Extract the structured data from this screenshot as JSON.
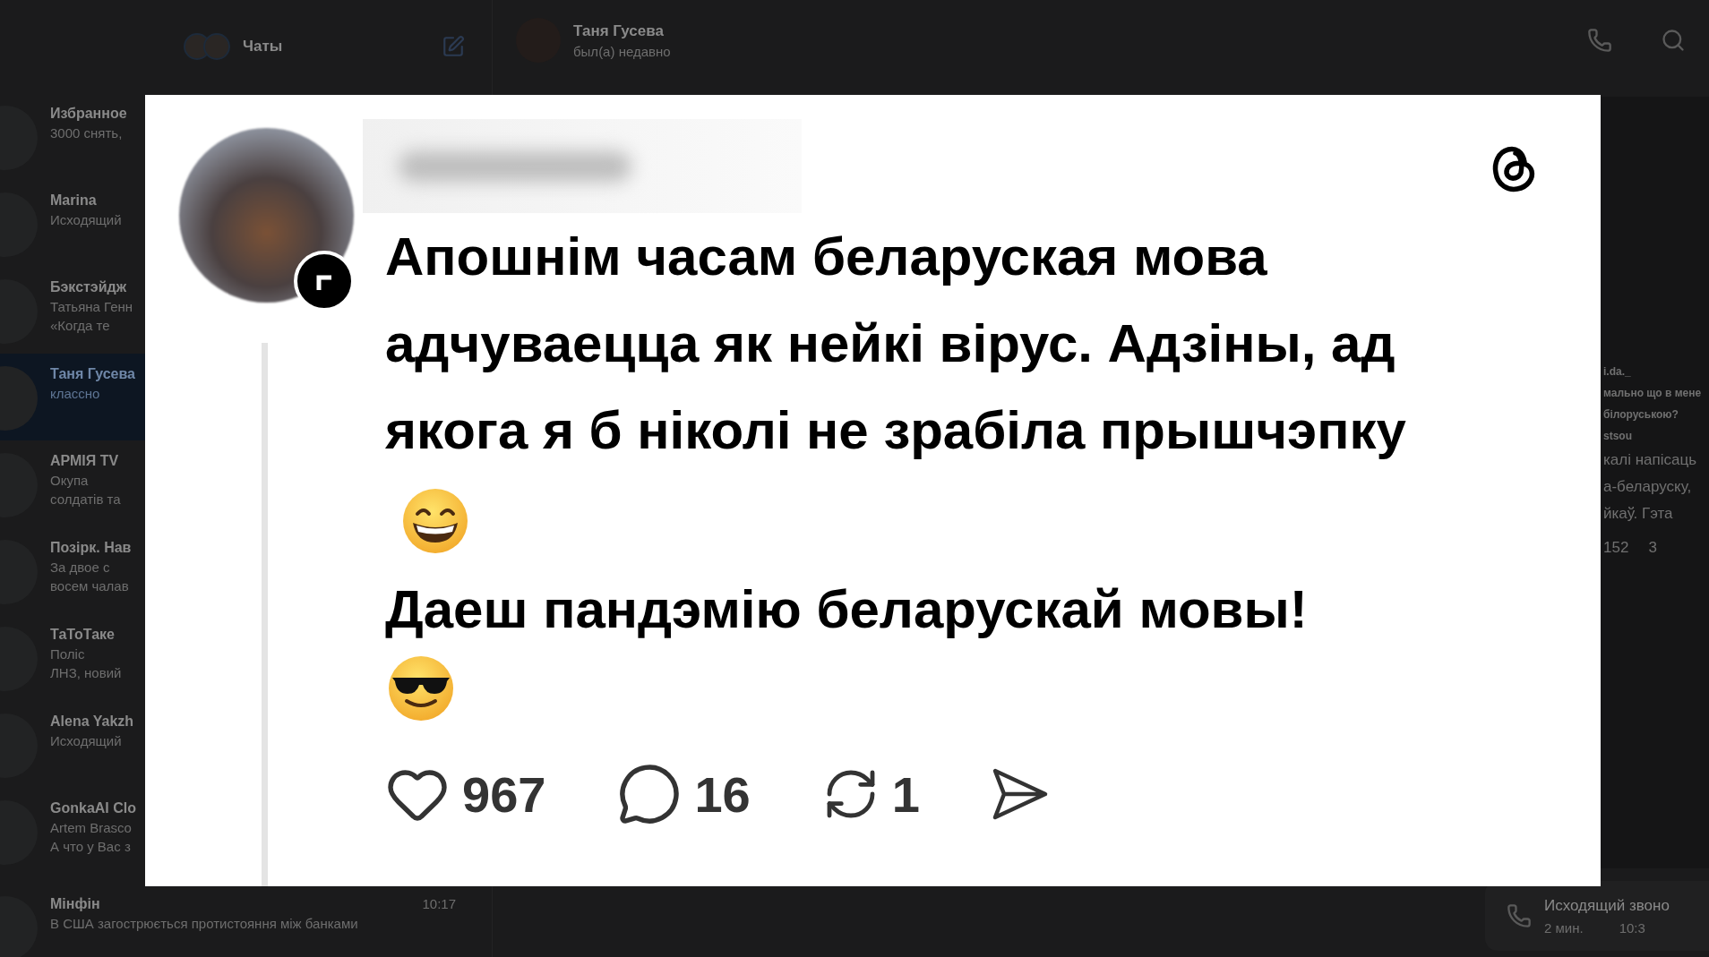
{
  "sidebar": {
    "title": "Чаты",
    "chats": [
      {
        "name": "Избранное",
        "lines": [
          "3000 снять,"
        ],
        "selected": false
      },
      {
        "name": "Marina",
        "lines": [
          "Исходящий"
        ],
        "selected": false
      },
      {
        "name": "Бэкстэйдж",
        "lines": [
          "Татьяна Генн",
          "«Когда те"
        ],
        "selected": false
      },
      {
        "name": "Таня Гусева",
        "lines": [
          "классно"
        ],
        "selected": true
      },
      {
        "name": "АРМІЯ TV",
        "lines": [
          "Окупа",
          "солдатів та"
        ],
        "selected": false
      },
      {
        "name": "Позірк. Нав",
        "lines": [
          "За двое с",
          "восем чалав"
        ],
        "selected": false
      },
      {
        "name": "ТаТоТаке",
        "lines": [
          "Поліс",
          "ЛНЗ, новий"
        ],
        "selected": false
      },
      {
        "name": "Alena Yakzh",
        "lines": [
          "Исходящий"
        ],
        "selected": false
      },
      {
        "name": "GonkaAI Clo",
        "lines": [
          "Artem Brasco",
          "А что у Вас з"
        ],
        "selected": false
      },
      {
        "name": "Мінфін",
        "time": "10:17",
        "lines": [
          "В США загострюється протистояння між банками"
        ],
        "selected": false
      }
    ]
  },
  "chat_header": {
    "name": "Таня Гусева",
    "status": "был(а) недавно"
  },
  "feed_strip": {
    "lines": [
      "i.da._",
      "мально що в мене",
      "білоруською?",
      "stsou",
      "калі напісаць",
      "а-беларуску,",
      "йкаў. Гэта"
    ],
    "counts": [
      "152",
      "3"
    ]
  },
  "call_message": {
    "title": "Исходящий звоно",
    "duration": "2 мин.",
    "time": "10:3"
  },
  "post": {
    "paragraphs": [
      {
        "text": "Апошнім часам беларуская мова адчуваецца як нейкі вірус. Адзіны, ад якога я б ніколі не зрабіла прышчэпку"
      },
      {
        "text": "Даеш пандэмію беларускай мовы!"
      }
    ],
    "actions": [
      {
        "kind": "like",
        "count": "967"
      },
      {
        "kind": "reply",
        "count": "16"
      },
      {
        "kind": "repost",
        "count": "1"
      },
      {
        "kind": "share"
      }
    ]
  }
}
